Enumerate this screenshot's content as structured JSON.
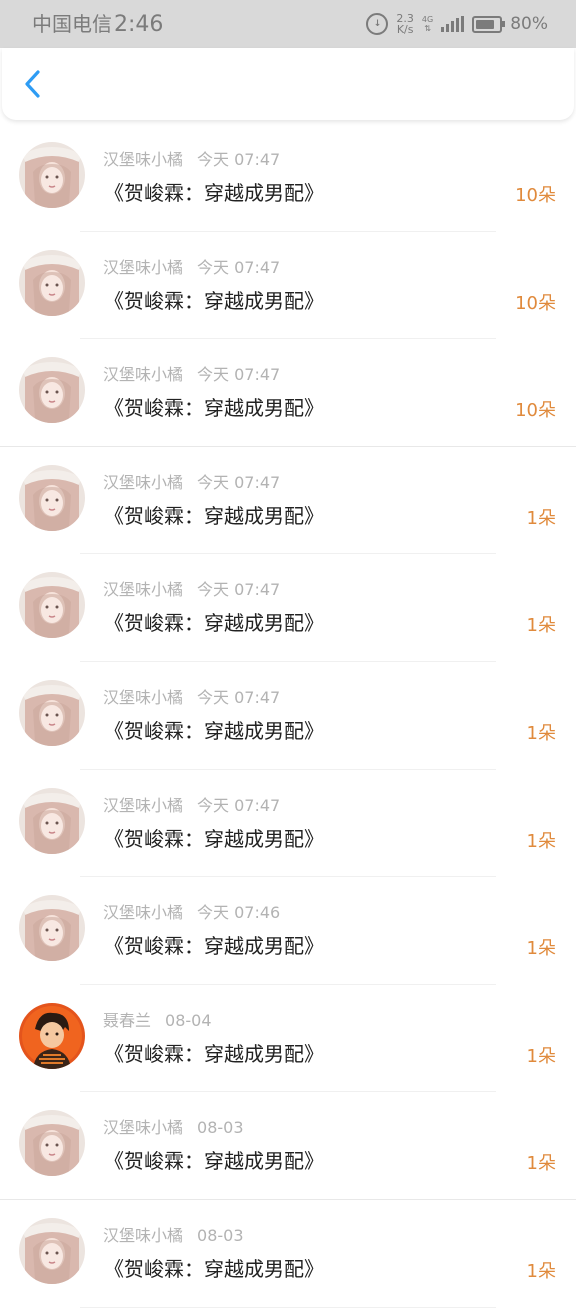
{
  "status_bar": {
    "carrier": "中国电信",
    "time": "2:46",
    "speed_value": "2.3",
    "speed_unit": "K/s",
    "network_type": "4G",
    "battery_level": 0.8,
    "battery_text": "80%"
  },
  "header": {
    "back_icon": "chevron-left-icon",
    "accent_color": "#2e9cf4"
  },
  "records": [
    {
      "user": "汉堡味小橘",
      "date": "今天 07:47",
      "title": "《贺峻霖：穿越成男配》",
      "count": "10朵",
      "avatar": "girl"
    },
    {
      "user": "汉堡味小橘",
      "date": "今天 07:47",
      "title": "《贺峻霖：穿越成男配》",
      "count": "10朵",
      "avatar": "girl"
    },
    {
      "user": "汉堡味小橘",
      "date": "今天 07:47",
      "title": "《贺峻霖：穿越成男配》",
      "count": "10朵",
      "avatar": "girl"
    },
    {
      "user": "汉堡味小橘",
      "date": "今天 07:47",
      "title": "《贺峻霖：穿越成男配》",
      "count": "1朵",
      "avatar": "girl"
    },
    {
      "user": "汉堡味小橘",
      "date": "今天 07:47",
      "title": "《贺峻霖：穿越成男配》",
      "count": "1朵",
      "avatar": "girl"
    },
    {
      "user": "汉堡味小橘",
      "date": "今天 07:47",
      "title": "《贺峻霖：穿越成男配》",
      "count": "1朵",
      "avatar": "girl"
    },
    {
      "user": "汉堡味小橘",
      "date": "今天 07:47",
      "title": "《贺峻霖：穿越成男配》",
      "count": "1朵",
      "avatar": "girl"
    },
    {
      "user": "汉堡味小橘",
      "date": "今天 07:46",
      "title": "《贺峻霖：穿越成男配》",
      "count": "1朵",
      "avatar": "girl"
    },
    {
      "user": "聂春兰",
      "date": "08-04",
      "title": "《贺峻霖：穿越成男配》",
      "count": "1朵",
      "avatar": "boy"
    },
    {
      "user": "汉堡味小橘",
      "date": "08-03",
      "title": "《贺峻霖：穿越成男配》",
      "count": "1朵",
      "avatar": "girl"
    },
    {
      "user": "汉堡味小橘",
      "date": "08-03",
      "title": "《贺峻霖：穿越成男配》",
      "count": "1朵",
      "avatar": "girl"
    }
  ],
  "colors": {
    "count": "#e08a3c",
    "meta": "#b3b3b3",
    "status_bar_bg": "#d9d9d9"
  }
}
